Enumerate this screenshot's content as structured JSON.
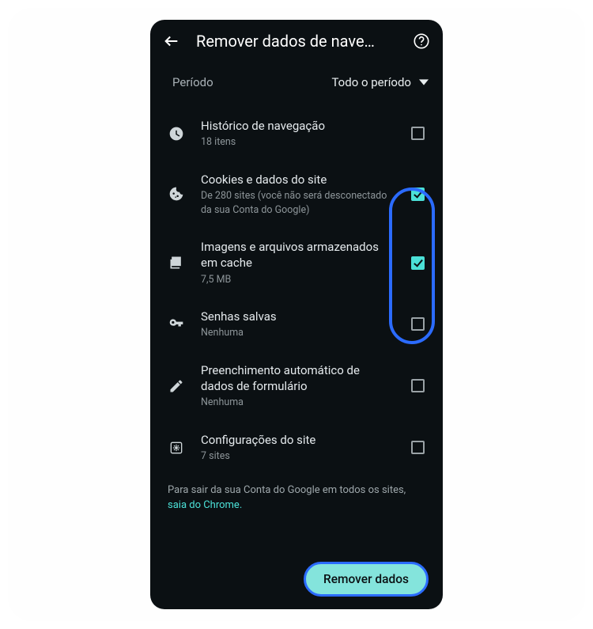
{
  "header": {
    "title": "Remover dados de nave…"
  },
  "period": {
    "label": "Período",
    "value": "Todo o período"
  },
  "items": [
    {
      "title": "Histórico de navegação",
      "sub": "18 itens",
      "checked": false
    },
    {
      "title": "Cookies e dados do site",
      "sub": "De 280 sites (você não será desconectado da sua Conta do Google)",
      "checked": true
    },
    {
      "title": "Imagens e arquivos armazenados em cache",
      "sub": "7,5 MB",
      "checked": true
    },
    {
      "title": "Senhas salvas",
      "sub": "Nenhuma",
      "checked": false
    },
    {
      "title": "Preenchimento automático de dados de formulário",
      "sub": "Nenhuma",
      "checked": false
    },
    {
      "title": "Configurações do site",
      "sub": "7 sites",
      "checked": false
    }
  ],
  "footer": {
    "text": "Para sair da sua Conta do Google em todos os sites, ",
    "link": "saia do Chrome."
  },
  "action": {
    "label": "Remover dados"
  }
}
